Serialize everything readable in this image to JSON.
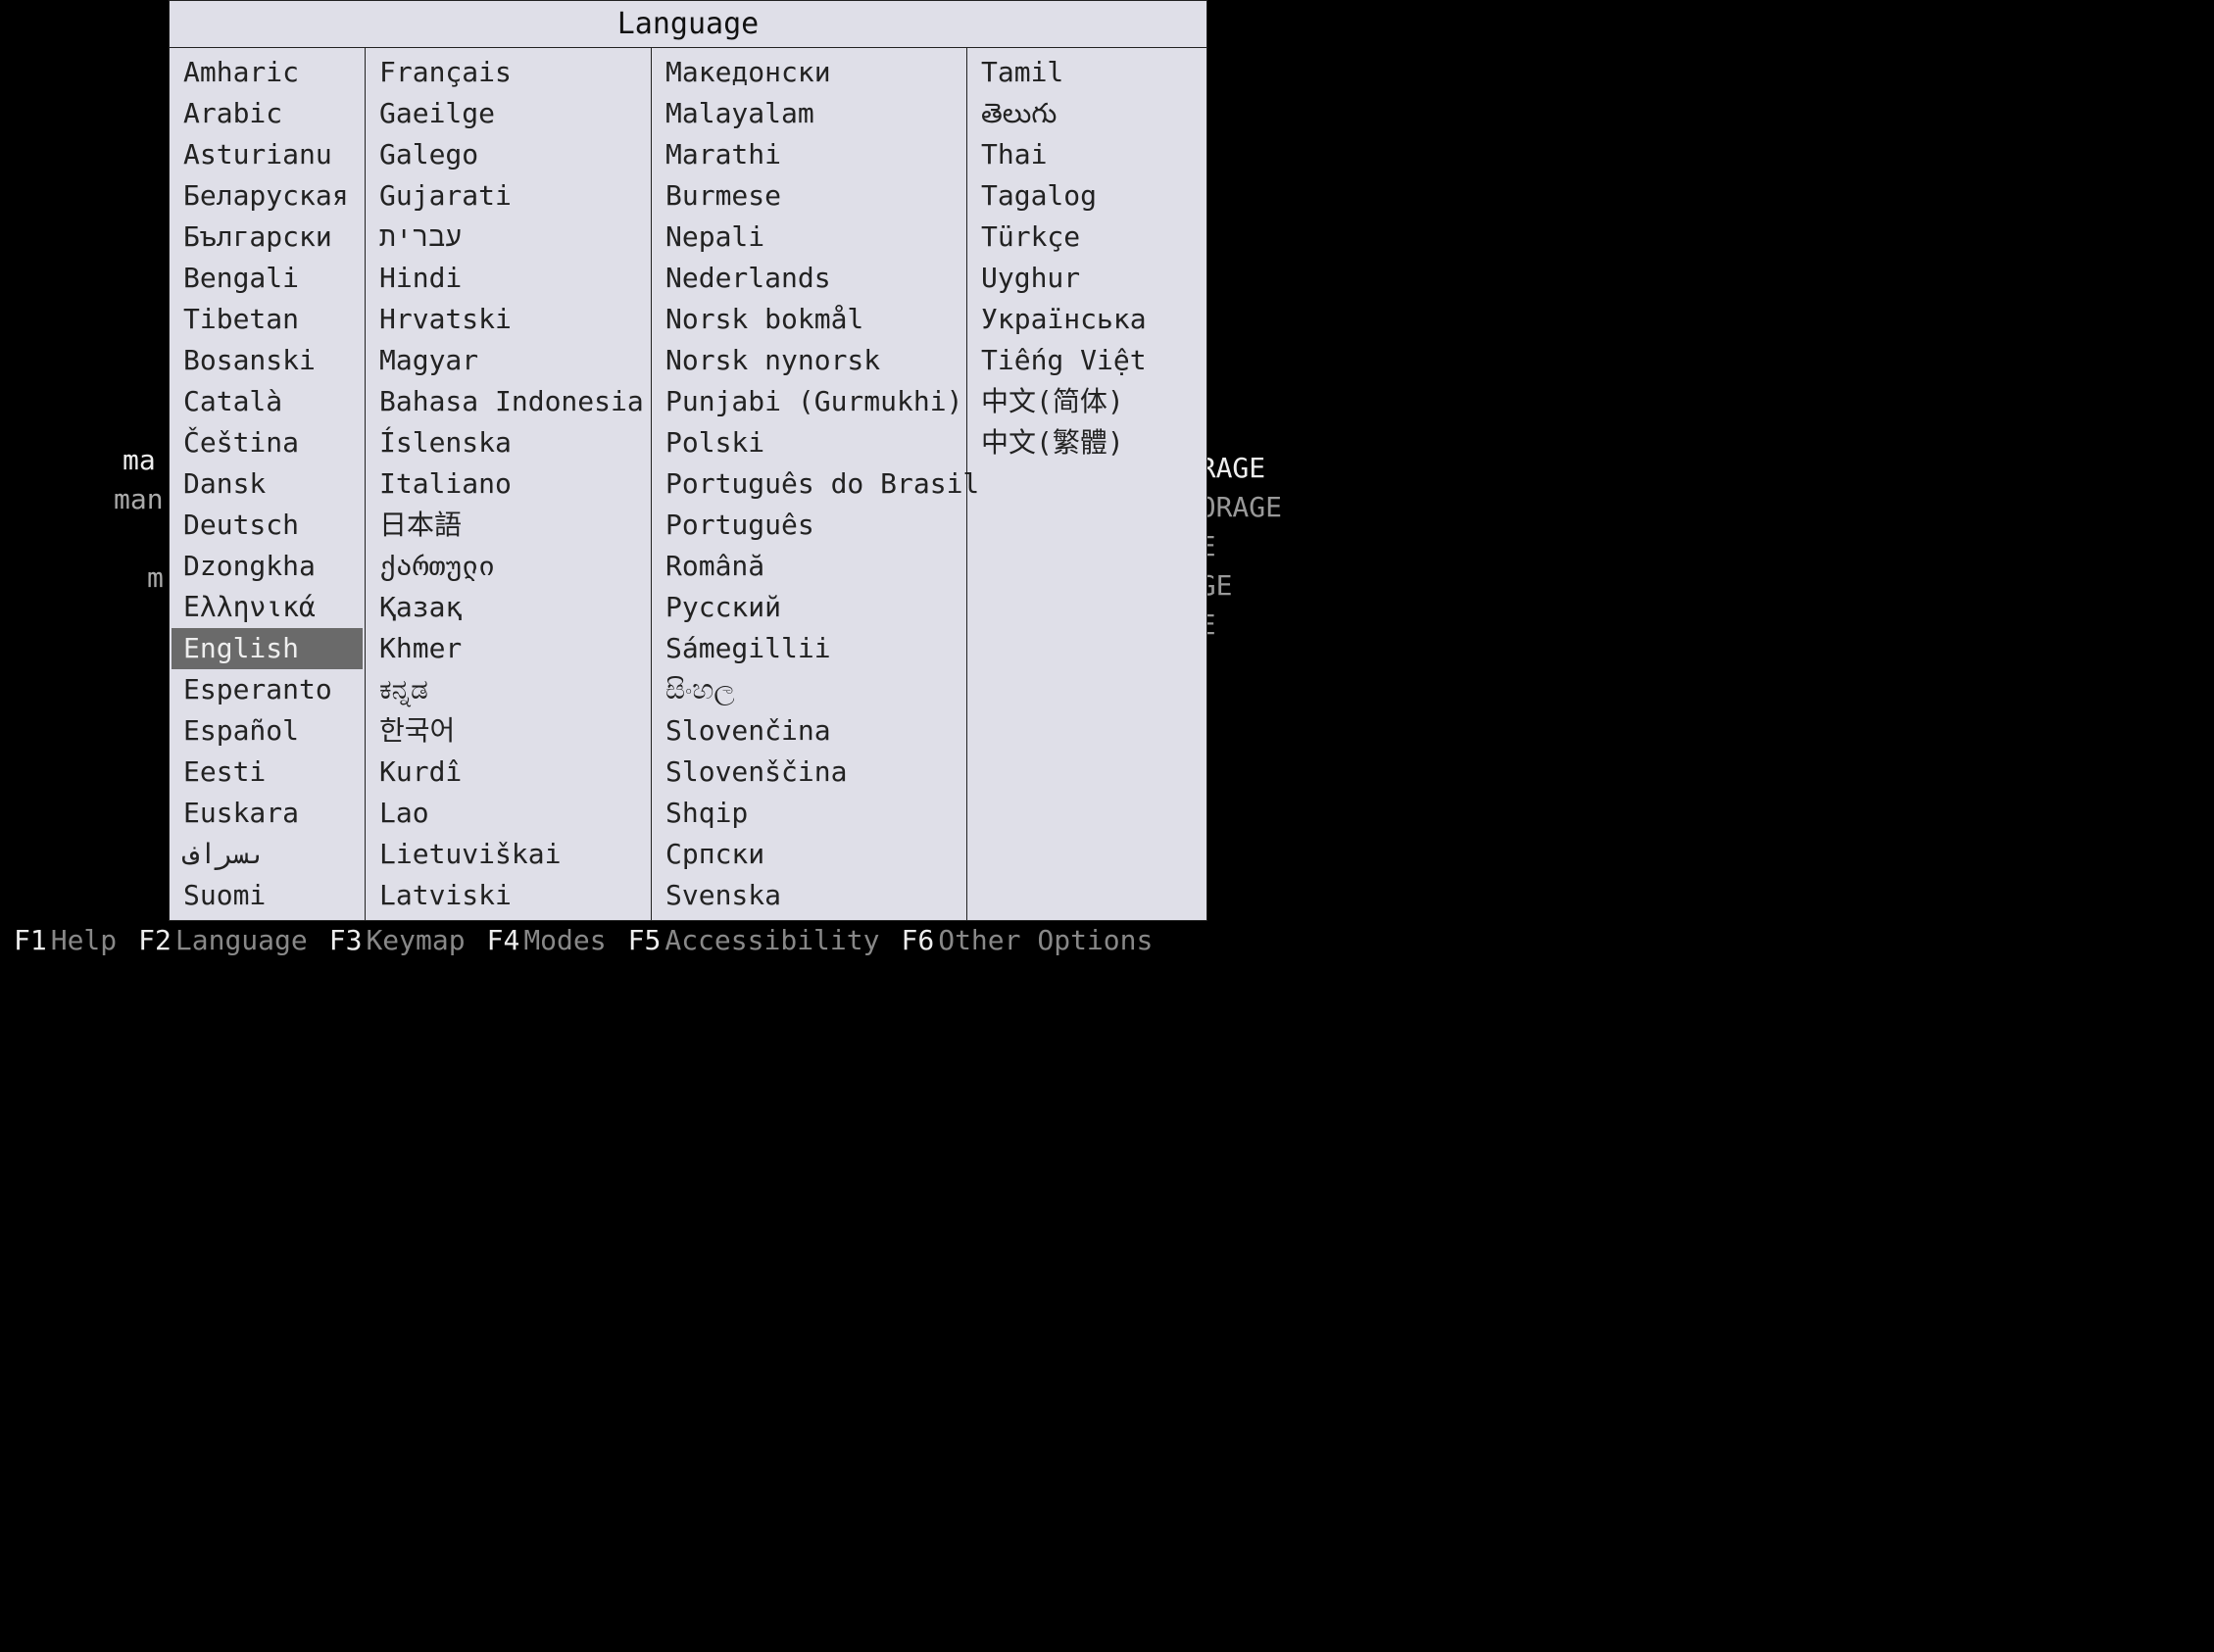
{
  "title": "Language",
  "selected": "English",
  "columns": [
    [
      "Amharic",
      "Arabic",
      "Asturianu",
      "Беларуская",
      "Български",
      "Bengali",
      "Tibetan",
      "Bosanski",
      "Català",
      "Čeština",
      "Dansk",
      "Deutsch",
      "Dzongkha",
      "Ελληνικά",
      "English",
      "Esperanto",
      "Español",
      "Eesti",
      "Euskara",
      "ىسراف",
      "Suomi"
    ],
    [
      "Français",
      "Gaeilge",
      "Galego",
      "Gujarati",
      "עברית",
      "Hindi",
      "Hrvatski",
      "Magyar",
      "Bahasa Indonesia",
      "Íslenska",
      "Italiano",
      "日本語",
      "ქართული",
      "Қазақ",
      "Khmer",
      "ಕನ್ನಡ",
      "한국어",
      "Kurdî",
      "Lao",
      "Lietuviškai",
      "Latviski"
    ],
    [
      "Македонски",
      "Malayalam",
      "Marathi",
      "Burmese",
      "Nepali",
      "Nederlands",
      "Norsk bokmål",
      "Norsk nynorsk",
      "Punjabi (Gurmukhi)",
      "Polski",
      "Português do Brasil",
      "Português",
      "Română",
      "Русский",
      "Sámegillii",
      "සිංහල",
      "Slovenčina",
      "Slovenščina",
      "Shqip",
      "Српски",
      "Svenska"
    ],
    [
      "Tamil",
      "తెలుగు",
      "Thai",
      "Tagalog",
      "Türkçe",
      "Uyghur",
      "Українська",
      "Tiếng Việt",
      "中文(简体)",
      "中文(繁體)"
    ]
  ],
  "bg_left": [
    "ma",
    "man",
    "",
    "m"
  ],
  "bg_left_first": "ma",
  "bg_right": [
    "D STORAGE",
    "GB STORAGE",
    "TORAGE",
    " STORAGE",
    "TORAGE"
  ],
  "footer": [
    {
      "key": "F1",
      "label": "Help"
    },
    {
      "key": "F2",
      "label": "Language"
    },
    {
      "key": "F3",
      "label": "Keymap"
    },
    {
      "key": "F4",
      "label": "Modes"
    },
    {
      "key": "F5",
      "label": "Accessibility"
    },
    {
      "key": "F6",
      "label": "Other Options"
    }
  ]
}
